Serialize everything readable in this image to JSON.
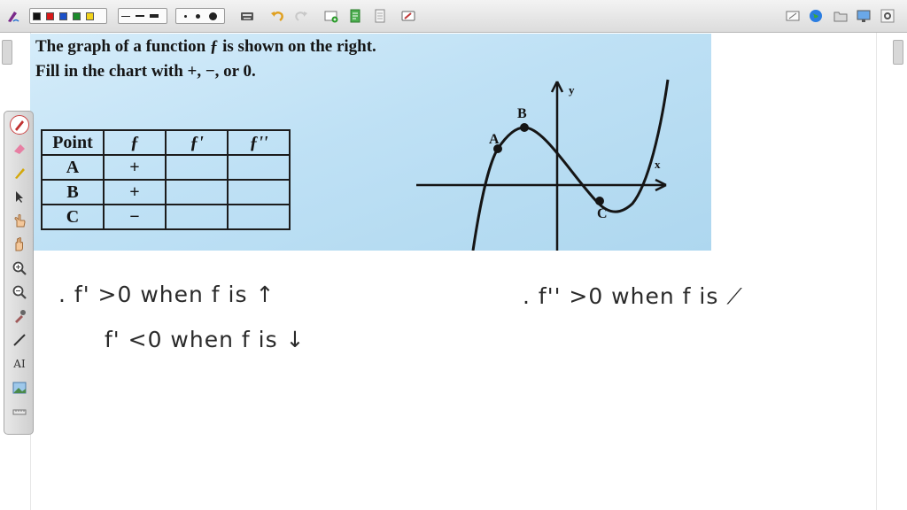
{
  "toolbar": {
    "color_swatches": [
      "#111111",
      "#d81818",
      "#1b50c8",
      "#1a8a2a",
      "#f2d21a"
    ],
    "accent": "#2a7de1"
  },
  "palette": {
    "tools": [
      "pen-icon",
      "eraser-icon",
      "highlighter-icon",
      "select-icon",
      "hand-point-icon",
      "hand-icon",
      "zoom-in-icon",
      "zoom-out-icon",
      "eyedropper-icon",
      "line-icon",
      "text-icon",
      "image-icon",
      "ruler-icon"
    ],
    "text_tool_label": "AI"
  },
  "problem": {
    "line1": "The graph of a function ƒ is shown on the right.",
    "line2": "Fill in the chart with +, −, or 0.",
    "table": {
      "headers": [
        "Point",
        "ƒ",
        "ƒ'",
        "ƒ''"
      ],
      "rows": [
        {
          "point": "A",
          "f": "+",
          "fp": "",
          "fpp": ""
        },
        {
          "point": "B",
          "f": "+",
          "fp": "",
          "fpp": ""
        },
        {
          "point": "C",
          "f": "−",
          "fp": "",
          "fpp": ""
        }
      ]
    },
    "graph": {
      "y_label": "y",
      "x_label": "x",
      "points": [
        "A",
        "B",
        "C"
      ]
    }
  },
  "notes": {
    "line1": ". f' >0   when   f   is  ↑",
    "line2": "f' <0   when   f   is  ↓",
    "line3": ". f'' >0   when   f   is  ⟋"
  }
}
